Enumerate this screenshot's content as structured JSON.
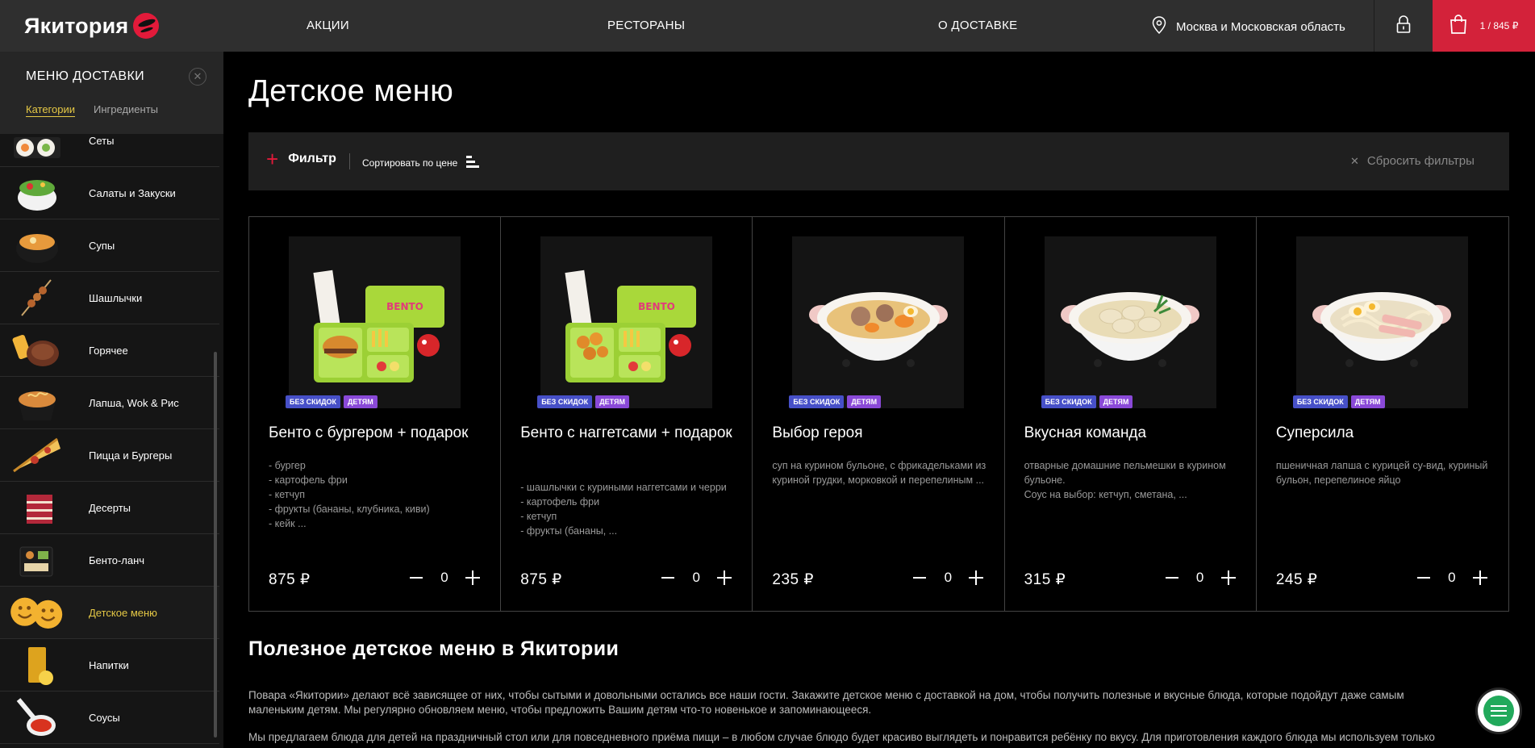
{
  "header": {
    "logo_text": "Якитория",
    "nav": [
      {
        "label": "АКЦИИ"
      },
      {
        "label": "РЕСТОРАНЫ"
      },
      {
        "label": "О ДОСТАВКЕ"
      }
    ],
    "location": "Москва и Московская область",
    "cart_text": "1 / 845 ₽"
  },
  "sidebar": {
    "title": "МЕНЮ ДОСТАВКИ",
    "tabs": [
      {
        "label": "Категории",
        "active": true
      },
      {
        "label": "Ингредиенты",
        "active": false
      }
    ],
    "items": [
      {
        "label": "Сеты",
        "icon": "rolls-set-icon",
        "active": false
      },
      {
        "label": "Салаты и Закуски",
        "icon": "salad-bowl-icon",
        "active": false
      },
      {
        "label": "Супы",
        "icon": "soup-bowl-icon",
        "active": false
      },
      {
        "label": "Шашлычки",
        "icon": "skewer-icon",
        "active": false
      },
      {
        "label": "Горячее",
        "icon": "steak-icon",
        "active": false
      },
      {
        "label": "Лапша, Wok & Рис",
        "icon": "noodles-icon",
        "active": false
      },
      {
        "label": "Пицца и Бургеры",
        "icon": "pizza-slice-icon",
        "active": false
      },
      {
        "label": "Десерты",
        "icon": "cake-icon",
        "active": false
      },
      {
        "label": "Бенто-ланч",
        "icon": "bento-box-icon",
        "active": false
      },
      {
        "label": "Детское меню",
        "icon": "smiley-potato-icon",
        "active": true
      },
      {
        "label": "Напитки",
        "icon": "drink-glass-icon",
        "active": false
      },
      {
        "label": "Соусы",
        "icon": "sauce-spoon-icon",
        "active": false
      }
    ]
  },
  "main": {
    "title": "Детское меню",
    "filter": {
      "filter_label": "Фильтр",
      "sort_label": "Сортировать по цене",
      "reset_label": "Сбросить фильтры"
    },
    "products": [
      {
        "title": "Бенто с бургером + подарок",
        "desc": "- бургер\n- картофель фри\n- кетчуп\n- фрукты (бананы, клубника, киви)\n- кейк ...",
        "price": "875 ₽",
        "qty": "0",
        "badges": [
          "БЕЗ СКИДОК",
          "ДЕТЯМ"
        ],
        "image": "bento-burger-image"
      },
      {
        "title": "Бенто с наггетсами + подарок",
        "desc": "- шашлычки с куриными наггетсами и черри\n- картофель фри\n- кетчуп\n- фрукты (бананы, ...",
        "price": "875 ₽",
        "qty": "0",
        "badges": [
          "БЕЗ СКИДОК",
          "ДЕТЯМ"
        ],
        "image": "bento-nuggets-image"
      },
      {
        "title": "Выбор героя",
        "desc": "суп на курином бульоне, с фрикадельками из куриной грудки, морковкой и перепелиным ...",
        "price": "235 ₽",
        "qty": "0",
        "badges": [
          "БЕЗ СКИДОК",
          "ДЕТЯМ"
        ],
        "image": "meatball-soup-image"
      },
      {
        "title": "Вкусная команда",
        "desc": "отварные домашние пельмешки в курином бульоне.\nСоус на выбор: кетчуп, сметана, ...",
        "price": "315 ₽",
        "qty": "0",
        "badges": [
          "БЕЗ СКИДОК",
          "ДЕТЯМ"
        ],
        "image": "dumpling-soup-image"
      },
      {
        "title": "Суперсила",
        "desc": "пшеничная лапша с курицей су-вид, куриный бульон, перепелиное яйцо",
        "price": "245 ₽",
        "qty": "0",
        "badges": [
          "БЕЗ СКИДОК",
          "ДЕТЯМ"
        ],
        "image": "noodle-soup-image"
      }
    ],
    "seo": {
      "title": "Полезное детское меню в Якитории",
      "p1": "Повара «Якитории» делают всё зависящее от них, чтобы сытыми и довольными остались все наши гости. Закажите детское меню с доставкой на дом, чтобы получить полезные и вкусные блюда, которые подойдут даже самым маленьким детям. Мы регулярно обновляем меню, чтобы предложить Вашим детям что-то новенькое и запоминающееся.",
      "p2": "Мы предлагаем блюда для детей на праздничный стол или для повседневного приёма пищи – в любом случае блюдо будет красиво выглядеть и понравится ребёнку по вкусу. Для приготовления каждого блюда мы используем только"
    }
  },
  "colors": {
    "accent_red": "#d3223a",
    "active_yellow": "#e5c845",
    "badge_blue": "#4750c8",
    "badge_purple": "#8a49d8",
    "chat_green": "#21a95b"
  }
}
